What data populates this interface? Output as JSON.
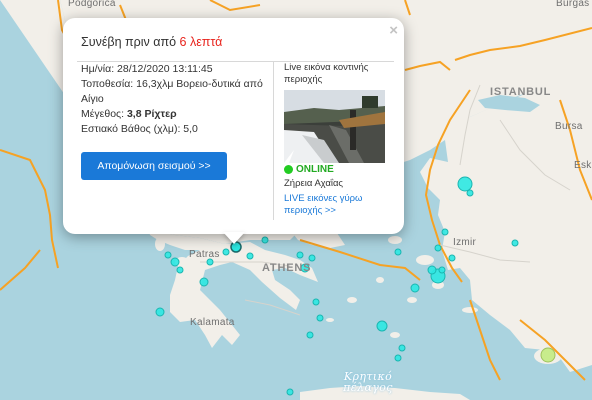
{
  "map": {
    "colors": {
      "land": "#f2efe9",
      "sea": "#aad3df",
      "borders": "#f6a224",
      "marker": "#2ce8e2",
      "marker_stroke": "#1bb5b0",
      "marker_old": "#c8ec8c"
    },
    "labels": {
      "podgorica": "Podgorica",
      "burgas": "Burgas",
      "istanbul": "ISTANBUL",
      "bursa": "Bursa",
      "eskisehir": "Esk",
      "izmir": "Izmir",
      "patras": "Patras",
      "athens": "ATHENS",
      "kalamata": "Kalamata",
      "cretan_sea": "Κρητικό\nπέλαγος"
    }
  },
  "popup": {
    "title_prefix": "Συνέβη πριν από",
    "title_ago": "6 λεπτά",
    "close": "×",
    "details": [
      {
        "label": "Ημ/νία:",
        "value": "28/12/2020 13:11:45",
        "bold": false
      },
      {
        "label": "Τοποθεσία:",
        "value": "16,3χλμ Βορειο-δυτικά από Αίγιο",
        "bold": false
      },
      {
        "label": "Μέγεθος:",
        "value": "3,8 Ρίχτερ",
        "bold": true
      },
      {
        "label": "Εστιακό Βάθος (χλμ):",
        "value": "5,0",
        "bold": false
      }
    ],
    "isolate_button": "Απομόνωση σεισμού >>",
    "camera_title": "Live εικόνα κοντινής περιοχής",
    "camera_status": "ONLINE",
    "camera_location": "Ζήρεια Αχαΐας",
    "camera_link": "LIVE εικόνες γύρω περιοχής >>"
  }
}
